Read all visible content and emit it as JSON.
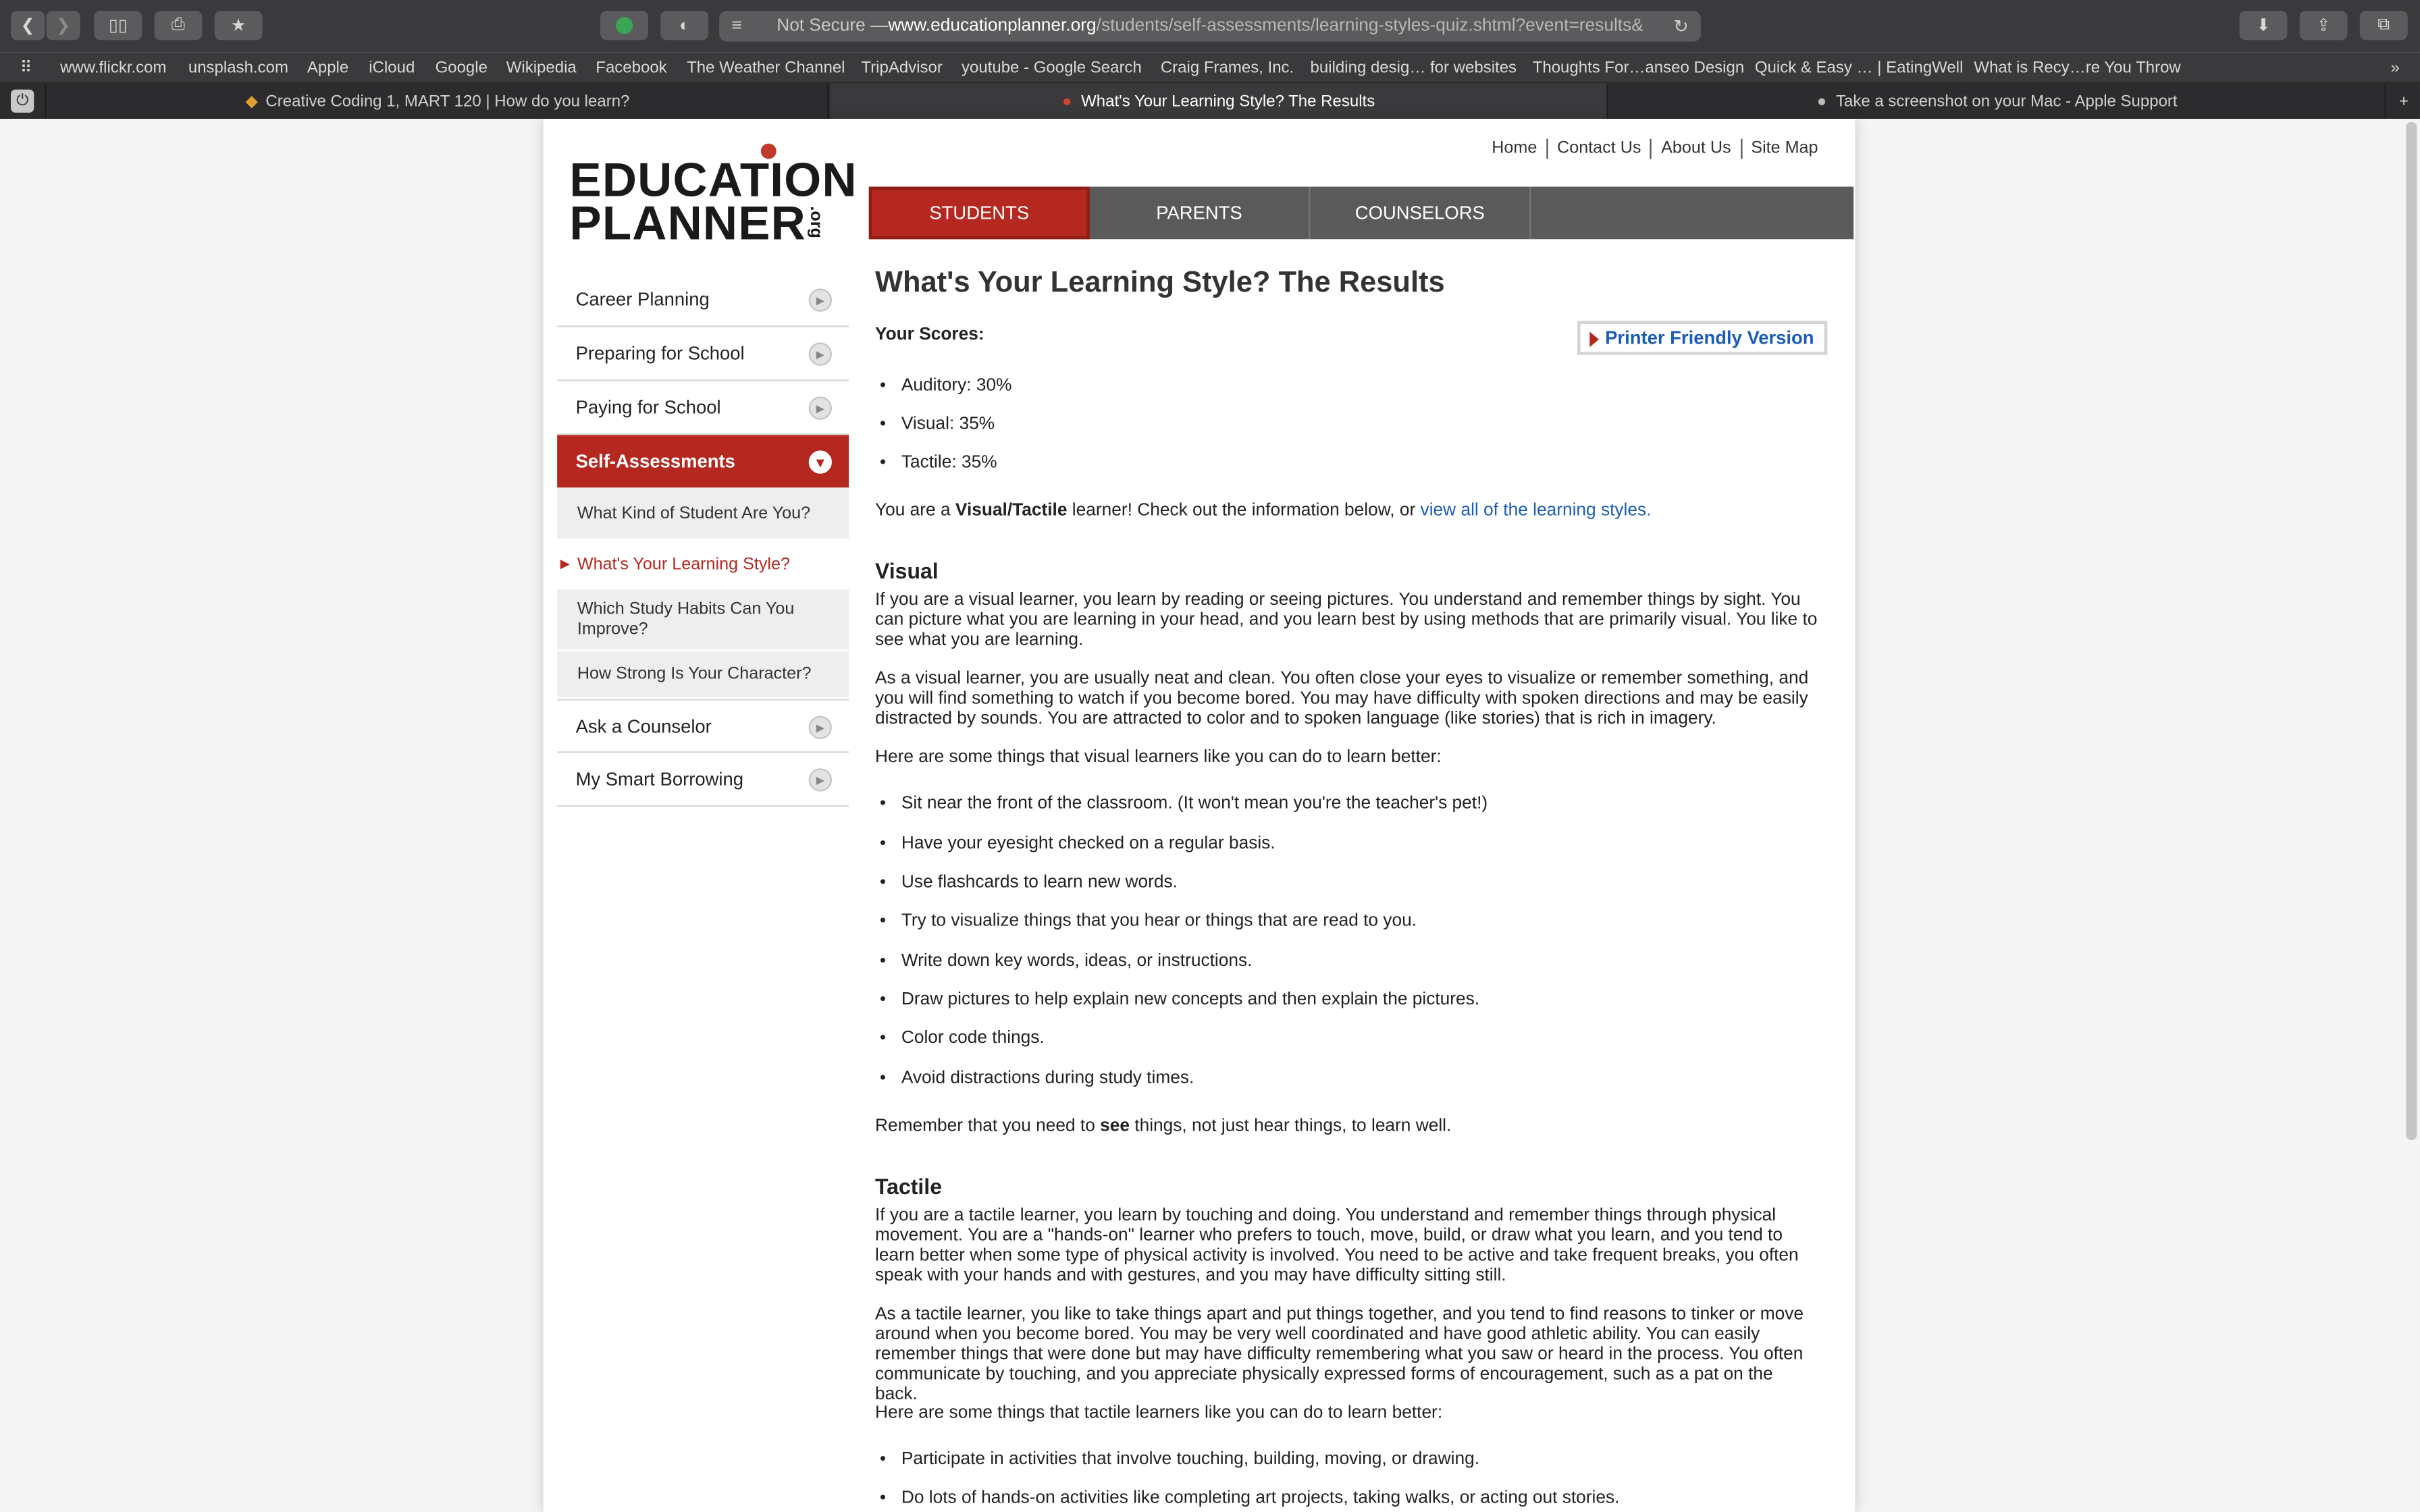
{
  "browser": {
    "url_prefix": "Not Secure — ",
    "url_domain": "www.educationplanner.org",
    "url_path": "/students/self-assessments/learning-styles-quiz.shtml?event=results&",
    "bookmarks": [
      "www.flickr.com",
      "unsplash.com",
      "Apple",
      "iCloud",
      "Google",
      "Wikipedia",
      "Facebook",
      "The Weather Channel",
      "TripAdvisor",
      "youtube - Google Search",
      "Craig Frames, Inc.",
      "building desig… for websites",
      "Thoughts For…anseo Design",
      "Quick & Easy … | EatingWell",
      "What is Recy…re You Throw"
    ],
    "tabs": [
      "Creative Coding 1, MART 120 | How do you learn?",
      "What's Your Learning Style? The Results",
      "Take a screenshot on your Mac - Apple Support"
    ]
  },
  "site": {
    "logo_line1": "EDUCATION",
    "logo_line2": "PLANNER",
    "logo_org": ".org",
    "top_links": [
      "Home",
      "Contact Us",
      "About Us",
      "Site Map"
    ],
    "main_nav": [
      "STUDENTS",
      "PARENTS",
      "COUNSELORS"
    ]
  },
  "sidebar": {
    "items": [
      "Career Planning",
      "Preparing for School",
      "Paying for School",
      "Self-Assessments"
    ],
    "sub_items": [
      "What Kind of Student Are You?",
      "What's Your Learning Style?",
      "Which Study Habits Can You Improve?",
      "How Strong Is Your Character?"
    ],
    "items_after": [
      "Ask a Counselor",
      "My Smart Borrowing"
    ]
  },
  "content": {
    "title": "What's Your Learning Style? The Results",
    "scores_label": "Your Scores:",
    "printer_label": "Printer Friendly Version",
    "scores": [
      "Auditory: 30%",
      "Visual: 35%",
      "Tactile: 35%"
    ],
    "result_pre": "You are a ",
    "result_bold": "Visual/Tactile",
    "result_mid": " learner! Check out the information below, or ",
    "result_link": "view all of the learning styles.",
    "visual_heading": "Visual",
    "visual_p1": "If you are a visual learner, you learn by reading or seeing pictures. You understand and remember things by sight. You can picture what you are learning in your head, and you learn best by using methods that are primarily visual. You like to see what you are learning.",
    "visual_p2": "As a visual learner, you are usually neat and clean. You often close your eyes to visualize or remember something, and you will find something to watch if you become bored. You may have difficulty with spoken directions and may be easily distracted by sounds. You are attracted to color and to spoken language (like stories) that is rich in imagery.",
    "visual_p3": "Here are some things that visual learners like you can do to learn better:",
    "visual_tips": [
      "Sit near the front of the classroom. (It won't mean you're the teacher's pet!)",
      "Have your eyesight checked on a regular basis.",
      "Use flashcards to learn new words.",
      "Try to visualize things that you hear or things that are read to you.",
      "Write down key words, ideas, or instructions.",
      "Draw pictures to help explain new concepts and then explain the pictures.",
      "Color code things.",
      "Avoid distractions during study times."
    ],
    "visual_remember_pre": "Remember that you need to ",
    "visual_remember_bold": "see",
    "visual_remember_post": " things, not just hear things, to learn well.",
    "tactile_heading": "Tactile",
    "tactile_p1": "If you are a tactile learner, you learn by touching and doing. You understand and remember things through physical movement. You are a \"hands-on\" learner who prefers to touch, move, build, or draw what you learn, and you tend to learn better when some type of physical activity is involved. You need to be active and take frequent breaks, you often speak with your hands and with gestures, and you may have difficulty sitting still.",
    "tactile_p2": "As a tactile learner, you like to take things apart and put things together, and you tend to find reasons to tinker or move around when you become bored. You may be very well coordinated and have good athletic ability. You can easily remember things that were done but may have difficulty remembering what you saw or heard in the process. You often communicate by touching, and you appreciate physically expressed forms of encouragement, such as a pat on the back.",
    "tactile_p3": "Here are some things that tactile learners like you can do to learn better:",
    "tactile_tips": [
      "Participate in activities that involve touching, building, moving, or drawing.",
      "Do lots of hands-on activities like completing art projects, taking walks, or acting out stories."
    ]
  },
  "colors": {
    "brand_red": "#b5281f",
    "link_blue": "#1b5db5",
    "nav_gray": "#5a5a5a"
  }
}
